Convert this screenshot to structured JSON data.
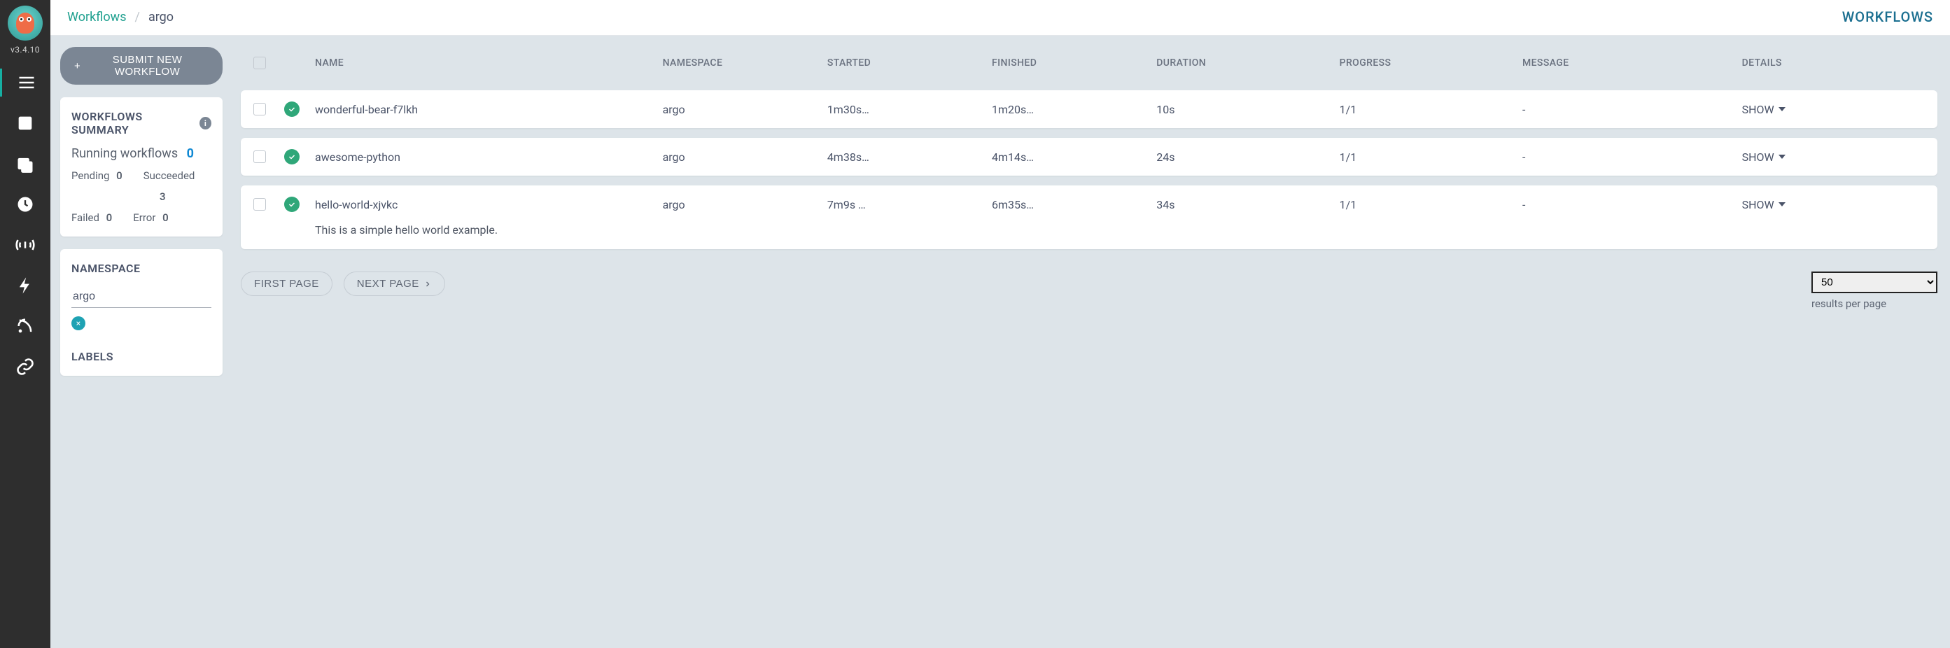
{
  "app": {
    "version": "v3.4.10",
    "page_title": "WORKFLOWS"
  },
  "breadcrumb": {
    "root": "Workflows",
    "current": "argo"
  },
  "toolbar": {
    "submit_label": "SUBMIT NEW WORKFLOW"
  },
  "summary": {
    "title": "WORKFLOWS SUMMARY",
    "running_label": "Running workflows",
    "running": "0",
    "pending_label": "Pending",
    "pending": "0",
    "succeeded_label": "Succeeded",
    "succeeded": "3",
    "failed_label": "Failed",
    "failed": "0",
    "error_label": "Error",
    "error": "0"
  },
  "namespace": {
    "title": "NAMESPACE",
    "value": "argo"
  },
  "labels": {
    "title": "LABELS"
  },
  "table": {
    "headers": {
      "name": "NAME",
      "namespace": "NAMESPACE",
      "started": "STARTED",
      "finished": "FINISHED",
      "duration": "DURATION",
      "progress": "PROGRESS",
      "message": "MESSAGE",
      "details": "DETAILS"
    },
    "rows": [
      {
        "name": "wonderful-bear-f7lkh",
        "namespace": "argo",
        "started": "1m30s…",
        "finished": "1m20s…",
        "duration": "10s",
        "progress": "1/1",
        "message": "-",
        "details": "SHOW",
        "description": ""
      },
      {
        "name": "awesome-python",
        "namespace": "argo",
        "started": "4m38s…",
        "finished": "4m14s…",
        "duration": "24s",
        "progress": "1/1",
        "message": "-",
        "details": "SHOW",
        "description": ""
      },
      {
        "name": "hello-world-xjvkc",
        "namespace": "argo",
        "started": "7m9s …",
        "finished": "6m35s…",
        "duration": "34s",
        "progress": "1/1",
        "message": "-",
        "details": "SHOW",
        "description": "This is a simple hello world example."
      }
    ]
  },
  "pagination": {
    "first_label": "FIRST PAGE",
    "next_label": "NEXT PAGE",
    "per_page_value": "50",
    "per_page_label": "results per page"
  }
}
